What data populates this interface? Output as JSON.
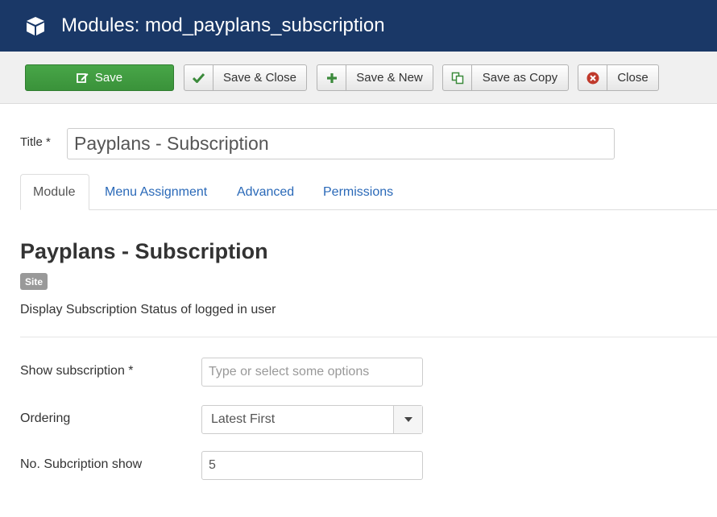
{
  "header": {
    "title": "Modules: mod_payplans_subscription",
    "icon": "cube-icon"
  },
  "toolbar": {
    "save": "Save",
    "save_close": "Save & Close",
    "save_new": "Save & New",
    "save_copy": "Save as Copy",
    "close": "Close"
  },
  "form": {
    "title_label": "Title *",
    "title_value": "Payplans - Subscription"
  },
  "tabs": [
    {
      "label": "Module",
      "active": true
    },
    {
      "label": "Menu Assignment",
      "active": false
    },
    {
      "label": "Advanced",
      "active": false
    },
    {
      "label": "Permissions",
      "active": false
    }
  ],
  "module": {
    "heading": "Payplans - Subscription",
    "badge": "Site",
    "description": "Display Subscription Status of logged in user"
  },
  "fields": {
    "show_subscription": {
      "label": "Show subscription *",
      "placeholder": "Type or select some options"
    },
    "ordering": {
      "label": "Ordering",
      "value": "Latest First"
    },
    "count": {
      "label": "No. Subcription show",
      "value": "5"
    }
  },
  "colors": {
    "header": "#1a3867",
    "save_button": "#46a546",
    "link": "#2a69b8"
  }
}
